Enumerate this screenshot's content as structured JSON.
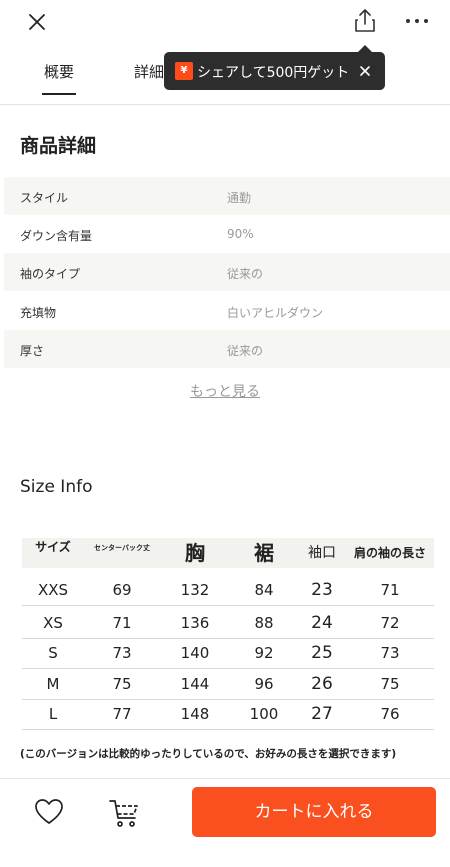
{
  "header": {
    "close_icon": "close-icon",
    "share_icon": "share-icon",
    "more_icon": "more-icon"
  },
  "tabs": [
    {
      "label": "概要"
    },
    {
      "label": "詳細"
    }
  ],
  "tooltip": {
    "coupon_icon": "¥",
    "text": "シェアして500円ゲット"
  },
  "product_details": {
    "title": "商品詳細",
    "rows": [
      {
        "label": "スタイル",
        "value": "通勤"
      },
      {
        "label": "ダウン含有量",
        "value": "90%"
      },
      {
        "label": "袖のタイプ",
        "value": "従来の"
      },
      {
        "label": "充填物",
        "value": "白いアヒルダウン"
      },
      {
        "label": "厚さ",
        "value": "従来の"
      }
    ],
    "see_more": "もっと見る"
  },
  "size_info": {
    "title": "Size Info",
    "columns": [
      "サイズ",
      "センターバック丈",
      "胸",
      "裾",
      "袖口",
      "肩の袖の長さ"
    ],
    "rows": [
      [
        "XXS",
        "69",
        "132",
        "84",
        "23",
        "71"
      ],
      [
        "XS",
        "71",
        "136",
        "88",
        "24",
        "72"
      ],
      [
        "S",
        "73",
        "140",
        "92",
        "25",
        "73"
      ],
      [
        "M",
        "75",
        "144",
        "96",
        "26",
        "75"
      ],
      [
        "L",
        "77",
        "148",
        "100",
        "27",
        "76"
      ]
    ],
    "note": "(このバージョンは比較的ゆったりしているので、お好みの長さを選択できます)"
  },
  "bottom_bar": {
    "favorite_icon": "heart-icon",
    "cart_icon": "cart-icon",
    "add_to_cart": "カートに入れる"
  },
  "colors": {
    "accent": "#fa4f1e",
    "tooltip_bg": "#2d2d2d",
    "row_shade": "#f6f6f2"
  }
}
